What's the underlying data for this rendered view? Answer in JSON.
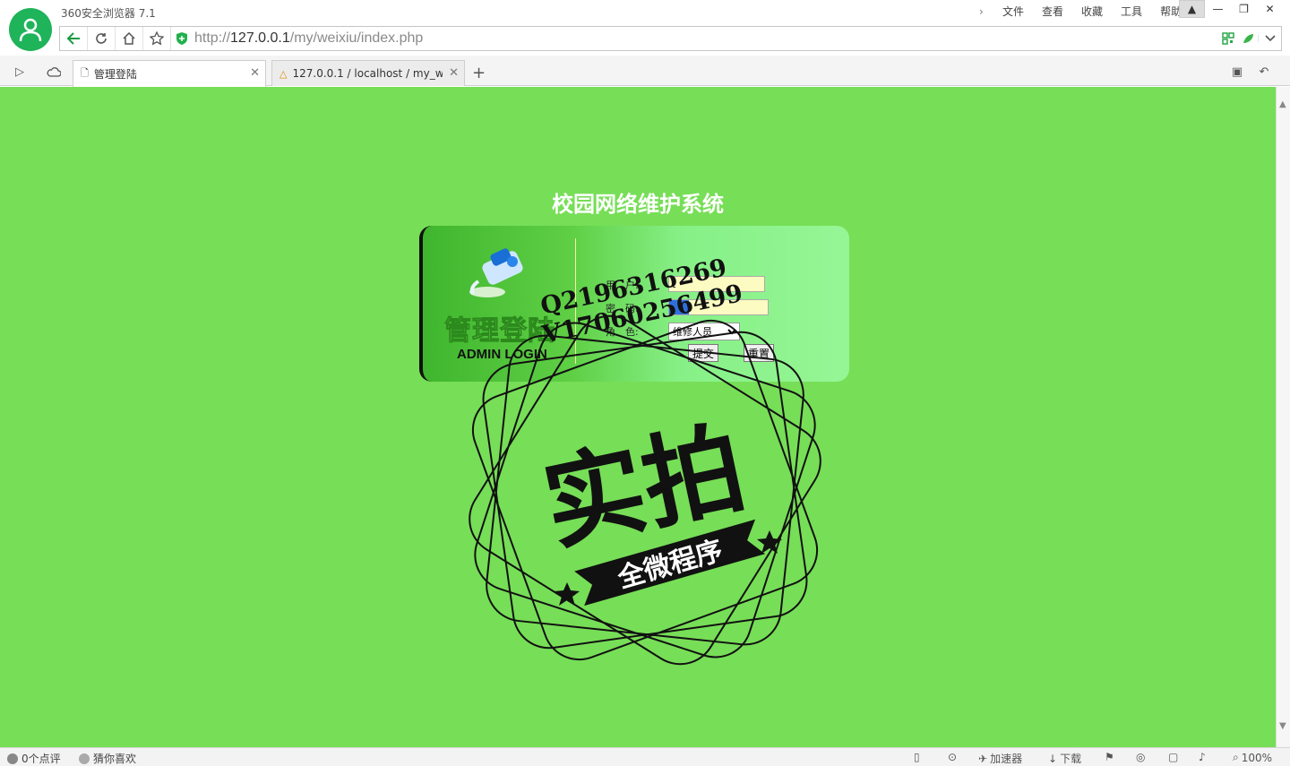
{
  "window": {
    "app_title": "360安全浏览器 7.1",
    "menu": [
      "文件",
      "查看",
      "收藏",
      "工具",
      "帮助"
    ]
  },
  "address": {
    "scheme": "http://",
    "host": "127.0.0.1",
    "path": "/my/weixiu/index.php"
  },
  "tabs": [
    {
      "title": "管理登陆",
      "active": true
    },
    {
      "title": "127.0.0.1 / localhost / my_we",
      "active": false
    }
  ],
  "page": {
    "system_title": "校园网络维护系统",
    "login_heading": "管理登陆",
    "login_subheading": "ADMIN LOGIN",
    "fields": {
      "user_label": "用　户:",
      "user_value": "t",
      "password_label": "密　码:",
      "role_label": "角　色:",
      "role_selected": "维修人员"
    },
    "buttons": {
      "submit": "提交",
      "reset": "重置"
    }
  },
  "watermark": {
    "line1": "Q2196316269",
    "line2": "V17060256499",
    "main": "实拍",
    "banner": "全微程序"
  },
  "status": {
    "comments": "0个点评",
    "guess": "猜你喜欢",
    "accelerator": "加速器",
    "download": "下载",
    "zoom": "100%"
  },
  "colors": {
    "page_bg": "#77de57",
    "accent_green": "#1fb35a"
  }
}
